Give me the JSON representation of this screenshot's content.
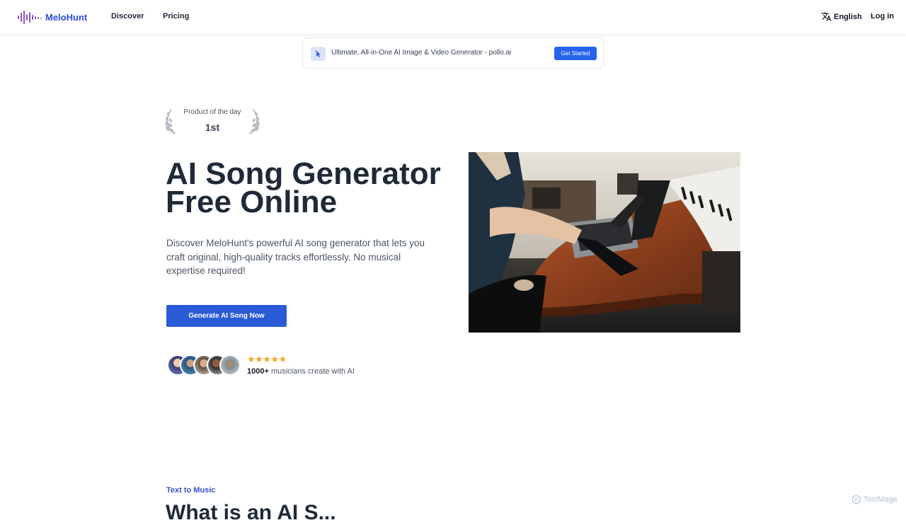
{
  "header": {
    "logo_text": "MeloHunt",
    "nav": [
      {
        "label": "Discover"
      },
      {
        "label": "Pricing"
      }
    ],
    "language_label": "English",
    "login_label": "Log in"
  },
  "promo": {
    "text": "Ultimate, All-in-One AI Image & Video Generator - pollo.ai",
    "button_label": "Get Started"
  },
  "award": {
    "label": "Product of the day",
    "rank": "1st"
  },
  "hero": {
    "title_line1": "AI Song Generator",
    "title_line2": "Free Online",
    "description": "Discover MeloHunt's powerful AI song generator that lets you craft original, high-quality tracks effortlessly. No musical expertise required!",
    "cta_label": "Generate AI Song Now",
    "rating_stars": "★★★★★",
    "rating_value": 5,
    "social_count": "1000+",
    "social_text": " musicians create with AI"
  },
  "section": {
    "label": "Text to Music",
    "title": "What is an AI S..."
  },
  "watermark": "ToolMage",
  "colors": {
    "brand": "#2d4fd7",
    "cta": "#2a5bd7",
    "stars": "#f5a623",
    "section_label": "#3b4fc4"
  }
}
